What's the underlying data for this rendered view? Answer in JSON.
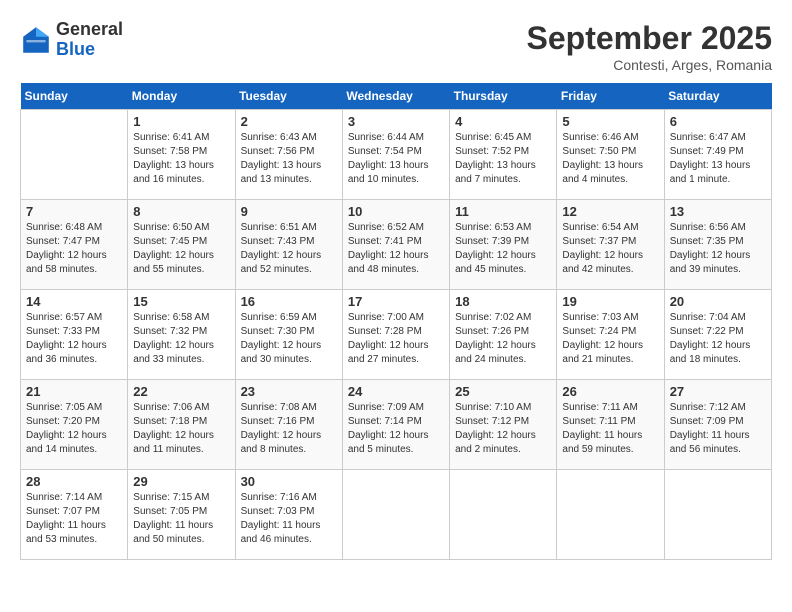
{
  "header": {
    "logo": {
      "general": "General",
      "blue": "Blue"
    },
    "month": "September 2025",
    "location": "Contesti, Arges, Romania"
  },
  "days_of_week": [
    "Sunday",
    "Monday",
    "Tuesday",
    "Wednesday",
    "Thursday",
    "Friday",
    "Saturday"
  ],
  "weeks": [
    [
      {
        "day": "",
        "info": ""
      },
      {
        "day": "1",
        "info": "Sunrise: 6:41 AM\nSunset: 7:58 PM\nDaylight: 13 hours\nand 16 minutes."
      },
      {
        "day": "2",
        "info": "Sunrise: 6:43 AM\nSunset: 7:56 PM\nDaylight: 13 hours\nand 13 minutes."
      },
      {
        "day": "3",
        "info": "Sunrise: 6:44 AM\nSunset: 7:54 PM\nDaylight: 13 hours\nand 10 minutes."
      },
      {
        "day": "4",
        "info": "Sunrise: 6:45 AM\nSunset: 7:52 PM\nDaylight: 13 hours\nand 7 minutes."
      },
      {
        "day": "5",
        "info": "Sunrise: 6:46 AM\nSunset: 7:50 PM\nDaylight: 13 hours\nand 4 minutes."
      },
      {
        "day": "6",
        "info": "Sunrise: 6:47 AM\nSunset: 7:49 PM\nDaylight: 13 hours\nand 1 minute."
      }
    ],
    [
      {
        "day": "7",
        "info": "Sunrise: 6:48 AM\nSunset: 7:47 PM\nDaylight: 12 hours\nand 58 minutes."
      },
      {
        "day": "8",
        "info": "Sunrise: 6:50 AM\nSunset: 7:45 PM\nDaylight: 12 hours\nand 55 minutes."
      },
      {
        "day": "9",
        "info": "Sunrise: 6:51 AM\nSunset: 7:43 PM\nDaylight: 12 hours\nand 52 minutes."
      },
      {
        "day": "10",
        "info": "Sunrise: 6:52 AM\nSunset: 7:41 PM\nDaylight: 12 hours\nand 48 minutes."
      },
      {
        "day": "11",
        "info": "Sunrise: 6:53 AM\nSunset: 7:39 PM\nDaylight: 12 hours\nand 45 minutes."
      },
      {
        "day": "12",
        "info": "Sunrise: 6:54 AM\nSunset: 7:37 PM\nDaylight: 12 hours\nand 42 minutes."
      },
      {
        "day": "13",
        "info": "Sunrise: 6:56 AM\nSunset: 7:35 PM\nDaylight: 12 hours\nand 39 minutes."
      }
    ],
    [
      {
        "day": "14",
        "info": "Sunrise: 6:57 AM\nSunset: 7:33 PM\nDaylight: 12 hours\nand 36 minutes."
      },
      {
        "day": "15",
        "info": "Sunrise: 6:58 AM\nSunset: 7:32 PM\nDaylight: 12 hours\nand 33 minutes."
      },
      {
        "day": "16",
        "info": "Sunrise: 6:59 AM\nSunset: 7:30 PM\nDaylight: 12 hours\nand 30 minutes."
      },
      {
        "day": "17",
        "info": "Sunrise: 7:00 AM\nSunset: 7:28 PM\nDaylight: 12 hours\nand 27 minutes."
      },
      {
        "day": "18",
        "info": "Sunrise: 7:02 AM\nSunset: 7:26 PM\nDaylight: 12 hours\nand 24 minutes."
      },
      {
        "day": "19",
        "info": "Sunrise: 7:03 AM\nSunset: 7:24 PM\nDaylight: 12 hours\nand 21 minutes."
      },
      {
        "day": "20",
        "info": "Sunrise: 7:04 AM\nSunset: 7:22 PM\nDaylight: 12 hours\nand 18 minutes."
      }
    ],
    [
      {
        "day": "21",
        "info": "Sunrise: 7:05 AM\nSunset: 7:20 PM\nDaylight: 12 hours\nand 14 minutes."
      },
      {
        "day": "22",
        "info": "Sunrise: 7:06 AM\nSunset: 7:18 PM\nDaylight: 12 hours\nand 11 minutes."
      },
      {
        "day": "23",
        "info": "Sunrise: 7:08 AM\nSunset: 7:16 PM\nDaylight: 12 hours\nand 8 minutes."
      },
      {
        "day": "24",
        "info": "Sunrise: 7:09 AM\nSunset: 7:14 PM\nDaylight: 12 hours\nand 5 minutes."
      },
      {
        "day": "25",
        "info": "Sunrise: 7:10 AM\nSunset: 7:12 PM\nDaylight: 12 hours\nand 2 minutes."
      },
      {
        "day": "26",
        "info": "Sunrise: 7:11 AM\nSunset: 7:11 PM\nDaylight: 11 hours\nand 59 minutes."
      },
      {
        "day": "27",
        "info": "Sunrise: 7:12 AM\nSunset: 7:09 PM\nDaylight: 11 hours\nand 56 minutes."
      }
    ],
    [
      {
        "day": "28",
        "info": "Sunrise: 7:14 AM\nSunset: 7:07 PM\nDaylight: 11 hours\nand 53 minutes."
      },
      {
        "day": "29",
        "info": "Sunrise: 7:15 AM\nSunset: 7:05 PM\nDaylight: 11 hours\nand 50 minutes."
      },
      {
        "day": "30",
        "info": "Sunrise: 7:16 AM\nSunset: 7:03 PM\nDaylight: 11 hours\nand 46 minutes."
      },
      {
        "day": "",
        "info": ""
      },
      {
        "day": "",
        "info": ""
      },
      {
        "day": "",
        "info": ""
      },
      {
        "day": "",
        "info": ""
      }
    ]
  ]
}
